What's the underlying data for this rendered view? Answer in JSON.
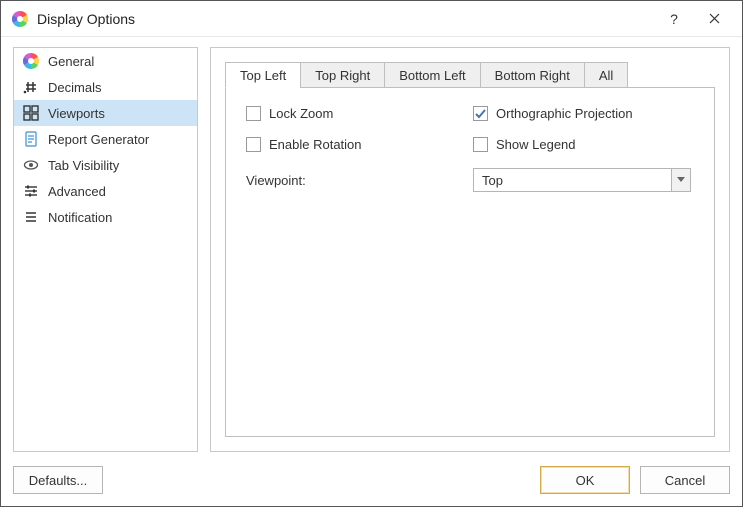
{
  "window": {
    "title": "Display Options"
  },
  "sidebar": {
    "items": [
      {
        "label": "General"
      },
      {
        "label": "Decimals"
      },
      {
        "label": "Viewports"
      },
      {
        "label": "Report Generator"
      },
      {
        "label": "Tab Visibility"
      },
      {
        "label": "Advanced"
      },
      {
        "label": "Notification"
      }
    ],
    "selected_index": 2
  },
  "tabs": {
    "items": [
      {
        "label": "Top Left"
      },
      {
        "label": "Top Right"
      },
      {
        "label": "Bottom Left"
      },
      {
        "label": "Bottom Right"
      },
      {
        "label": "All"
      }
    ],
    "active_index": 0
  },
  "panel": {
    "lock_zoom": {
      "label": "Lock Zoom",
      "checked": false
    },
    "enable_rotation": {
      "label": "Enable Rotation",
      "checked": false
    },
    "orthographic_projection": {
      "label": "Orthographic Projection",
      "checked": true
    },
    "show_legend": {
      "label": "Show Legend",
      "checked": false
    },
    "viewpoint_label": "Viewpoint:",
    "viewpoint_value": "Top"
  },
  "footer": {
    "defaults_label": "Defaults...",
    "ok_label": "OK",
    "cancel_label": "Cancel"
  }
}
